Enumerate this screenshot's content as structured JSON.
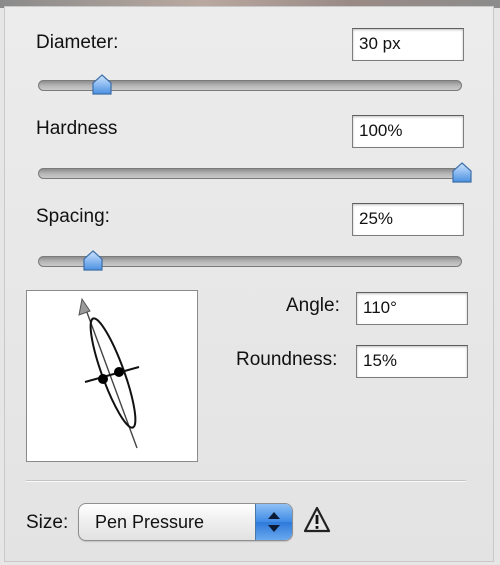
{
  "brush": {
    "diameter": {
      "label": "Diameter:",
      "value": "30 px",
      "slider_fraction": 0.15
    },
    "hardness": {
      "label": "Hardness",
      "value": "100%",
      "slider_fraction": 1.0
    },
    "spacing": {
      "label": "Spacing:",
      "value": "25%",
      "slider_fraction": 0.13
    }
  },
  "shape": {
    "angle": {
      "label": "Angle:",
      "value": "110°"
    },
    "roundness": {
      "label": "Roundness:",
      "value": "15%"
    }
  },
  "size_control": {
    "label": "Size:",
    "selected": "Pen Pressure",
    "warning_icon": "warning-icon"
  },
  "colors": {
    "panel_bg": "#e6e6e6",
    "slider_thumb": "#6aa9f0",
    "select_button": "#3f8ae6"
  }
}
